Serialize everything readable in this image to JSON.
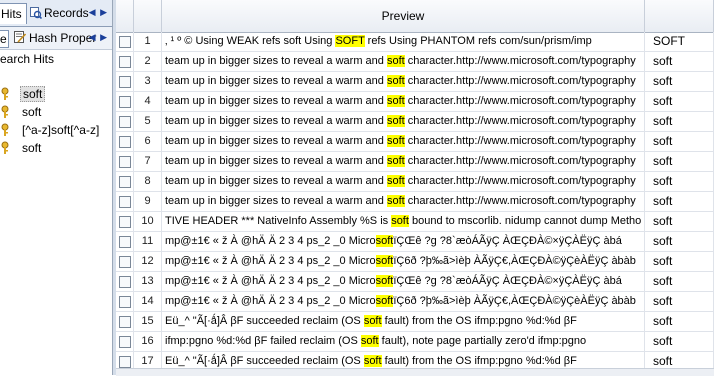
{
  "left_panel": {
    "tab_hits": "Hits",
    "tab_records": "Records",
    "arrows": "◀ ▶",
    "sub_tab_e": "e",
    "sub_tab_hash": "Hash Proper",
    "tree_title": "earch Hits",
    "items": [
      "soft",
      "soft",
      "[^a-z]soft[^a-z]",
      "soft"
    ]
  },
  "grid": {
    "header_preview": "Preview",
    "rows": [
      {
        "num": "1",
        "pre": "   ‚ ¹ º © Using WEAK refs  soft Using ",
        "hit": "SOFT",
        "post": " refs  Using PHANTOM refs  com/sun/prism/imp",
        "term": "SOFT"
      },
      {
        "num": "2",
        "pre": "team up in bigger sizes to reveal a warm and ",
        "hit": "soft",
        "post": " character.http://www.microsoft.com/typography",
        "term": "soft"
      },
      {
        "num": "3",
        "pre": "team up in bigger sizes to reveal a warm and ",
        "hit": "soft",
        "post": " character.http://www.microsoft.com/typography",
        "term": "soft"
      },
      {
        "num": "4",
        "pre": "team up in bigger sizes to reveal a warm and ",
        "hit": "soft",
        "post": " character.http://www.microsoft.com/typography",
        "term": "soft"
      },
      {
        "num": "5",
        "pre": "team up in bigger sizes to reveal a warm and ",
        "hit": "soft",
        "post": " character.http://www.microsoft.com/typography",
        "term": "soft"
      },
      {
        "num": "6",
        "pre": "team up in bigger sizes to reveal a warm and ",
        "hit": "soft",
        "post": " character.http://www.microsoft.com/typography",
        "term": "soft"
      },
      {
        "num": "7",
        "pre": "team up in bigger sizes to reveal a warm and ",
        "hit": "soft",
        "post": " character.http://www.microsoft.com/typography",
        "term": "soft"
      },
      {
        "num": "8",
        "pre": "team up in bigger sizes to reveal a warm and ",
        "hit": "soft",
        "post": " character.http://www.microsoft.com/typography",
        "term": "soft"
      },
      {
        "num": "9",
        "pre": "team up in bigger sizes to reveal a warm and ",
        "hit": "soft",
        "post": " character.http://www.microsoft.com/typography",
        "term": "soft"
      },
      {
        "num": "10",
        "pre": "TIVE HEADER ***  NativeInfo  Assembly %S is ",
        "hit": "soft",
        "post": " bound to mscorlib.  nidump cannot dump Metho",
        "term": "soft"
      },
      {
        "num": "11",
        "pre": " mp@±1€ « ž À @hÄ Ä 2   3  4 ps_2 _0 Micro",
        "hit": "soft",
        "post": "ïÇŒê  ?g  ?8`æòÁÃÿÇ  ÀŒÇÐÀ©×ÿÇÀËÿÇ àbá",
        "term": "soft"
      },
      {
        "num": "12",
        "pre": " mp@±1€ « ž À @hÄ Ä 2   3  4 ps_2 _0 Micro",
        "hit": "soft",
        "post": "ïÇ6ð  ?þ‰ã>ìèþ ÀÃÿÇ€,ÀŒÇÐÀ©ÿÇèÀËÿÇ àbàb",
        "term": "soft"
      },
      {
        "num": "13",
        "pre": " mp@±1€ « ž À @hÄ Ä 2   3  4 ps_2 _0 Micro",
        "hit": "soft",
        "post": "ïÇŒê  ?g  ?8`æòÁÃÿÇ  ÀŒÇÐÀ©×ÿÇÀËÿÇ àbá",
        "term": "soft"
      },
      {
        "num": "14",
        "pre": " mp@±1€ « ž À @hÄ Ä 2   3  4 ps_2 _0 Micro",
        "hit": "soft",
        "post": "ïÇ6ð  ?þ‰ã>ìèþ ÀÃÿÇ€,ÀŒÇÐÀ©ÿÇèÀËÿÇ àbàb",
        "term": "soft"
      },
      {
        "num": "15",
        "pre": "Eü_^ \"Ã[·ǻ]Â  βF succeeded reclaim (OS ",
        "hit": "soft",
        "post": " fault) from the OS ifmp:pgno %d:%d βF",
        "term": "soft"
      },
      {
        "num": "16",
        "pre": "ifmp:pgno %d:%d βF failed reclaim (OS ",
        "hit": "soft",
        "post": " fault), note page partially zero'd ifmp:pgno",
        "term": "soft"
      },
      {
        "num": "17",
        "pre": "Eü_^ \"Ã[·ǻ]Â  βF succeeded reclaim (OS ",
        "hit": "soft",
        "post": " fault) from the OS ifmp:pgno %d:%d βF",
        "term": "soft"
      }
    ]
  }
}
